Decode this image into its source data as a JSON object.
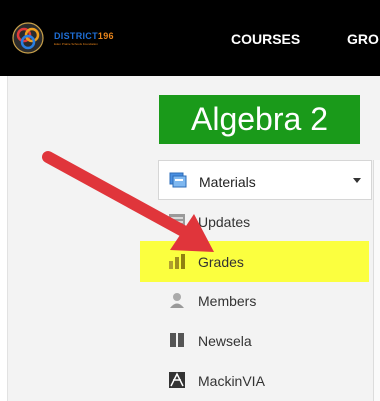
{
  "header": {
    "logo_name": "DISTRICT",
    "logo_number": "196",
    "logo_tagline": "Eden Prairie Schools Foundation",
    "nav": [
      "COURSES",
      "GRO"
    ]
  },
  "course": {
    "title": "Algebra 2"
  },
  "materials": {
    "label": "Materials"
  },
  "menu": {
    "items": [
      {
        "label": "Updates",
        "icon": "updates-icon"
      },
      {
        "label": "Grades",
        "icon": "grades-icon"
      },
      {
        "label": "Members",
        "icon": "members-icon"
      },
      {
        "label": "Newsela",
        "icon": "newsela-icon"
      },
      {
        "label": "MackinVIA",
        "icon": "mackinvia-icon"
      }
    ]
  },
  "colors": {
    "title_bg": "#1a9a1a",
    "highlight": "#fbff3f",
    "arrow": "#e0353b",
    "topbar": "#000000"
  }
}
